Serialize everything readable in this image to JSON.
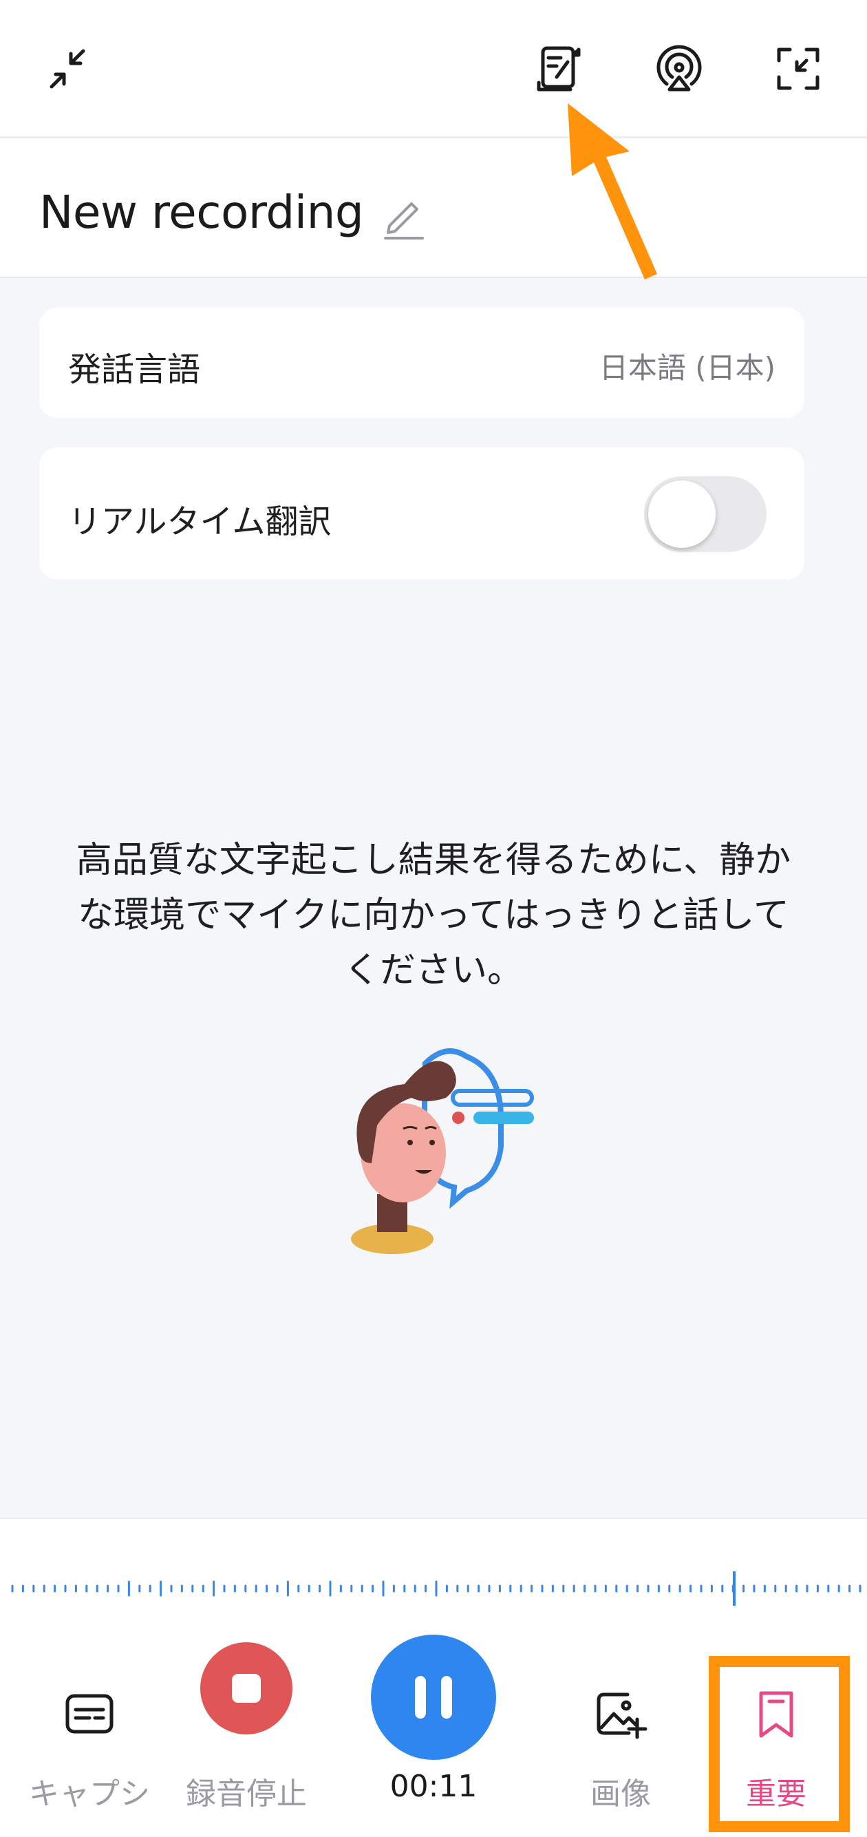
{
  "header": {
    "icons": [
      "collapse-icon",
      "transcript-icon",
      "cast-icon",
      "fullscreen-icon"
    ]
  },
  "recording": {
    "title": "New recording"
  },
  "settings": {
    "language_label": "発話言語",
    "language_value": "日本語 (日本)",
    "realtime_label": "リアルタイム翻訳",
    "realtime_enabled": false
  },
  "hint": {
    "line1": "高品質な文字起こし結果を得るために、静か",
    "line2": "な環境でマイクに向かってはっきりと話して",
    "line3": "ください。"
  },
  "controls": {
    "caption_label": "キャプシ",
    "stop_label": "録音停止",
    "timer": "00:11",
    "image_label": "画像",
    "important_label": "重要"
  },
  "colors": {
    "accent_blue": "#2f86ef",
    "stop_red": "#e05555",
    "important_pink": "#e64a86",
    "annotation_orange": "#ff940c"
  }
}
